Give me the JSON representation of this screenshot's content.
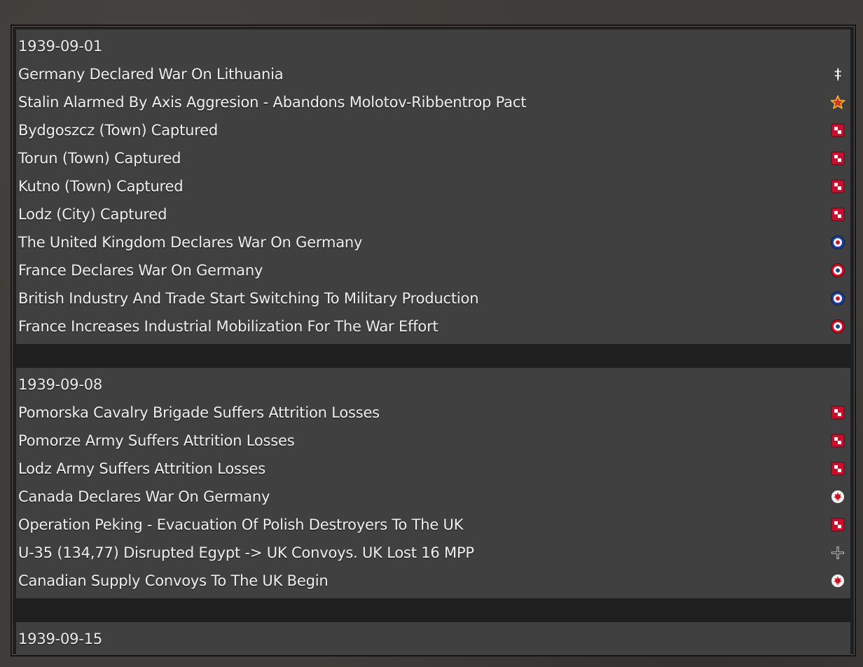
{
  "groups": [
    {
      "date": "1939-09-01",
      "events": [
        {
          "text": "Germany Declared War On Lithuania",
          "icon": "lithuania-roundel-icon"
        },
        {
          "text": "Stalin Alarmed By Axis Aggresion - Abandons Molotov-Ribbentrop Pact",
          "icon": "soviet-star-icon"
        },
        {
          "text": "Bydgoszcz (Town) Captured",
          "icon": "poland-checker-icon"
        },
        {
          "text": "Torun (Town) Captured",
          "icon": "poland-checker-icon"
        },
        {
          "text": "Kutno (Town) Captured",
          "icon": "poland-checker-icon"
        },
        {
          "text": "Lodz (City) Captured",
          "icon": "poland-checker-icon"
        },
        {
          "text": "The United Kingdom Declares War On Germany",
          "icon": "uk-roundel-icon"
        },
        {
          "text": "France Declares War On Germany",
          "icon": "france-roundel-icon"
        },
        {
          "text": "British Industry And Trade Start Switching To Military Production",
          "icon": "uk-roundel-icon"
        },
        {
          "text": "France Increases Industrial Mobilization For The War Effort",
          "icon": "france-roundel-icon"
        }
      ]
    },
    {
      "date": "1939-09-08",
      "events": [
        {
          "text": "Pomorska Cavalry Brigade Suffers Attrition Losses",
          "icon": "poland-checker-icon"
        },
        {
          "text": "Pomorze Army Suffers Attrition Losses",
          "icon": "poland-checker-icon"
        },
        {
          "text": "Lodz Army Suffers Attrition Losses",
          "icon": "poland-checker-icon"
        },
        {
          "text": "Canada Declares War On Germany",
          "icon": "canada-maple-icon"
        },
        {
          "text": "Operation Peking - Evacuation Of Polish Destroyers To The UK",
          "icon": "poland-checker-icon"
        },
        {
          "text": "U-35 (134,77) Disrupted Egypt -> UK Convoys.  UK Lost 16 MPP",
          "icon": "german-cross-icon"
        },
        {
          "text": "Canadian Supply Convoys To The UK Begin",
          "icon": "canada-maple-icon"
        }
      ]
    },
    {
      "date": "1939-09-15",
      "events": []
    }
  ]
}
